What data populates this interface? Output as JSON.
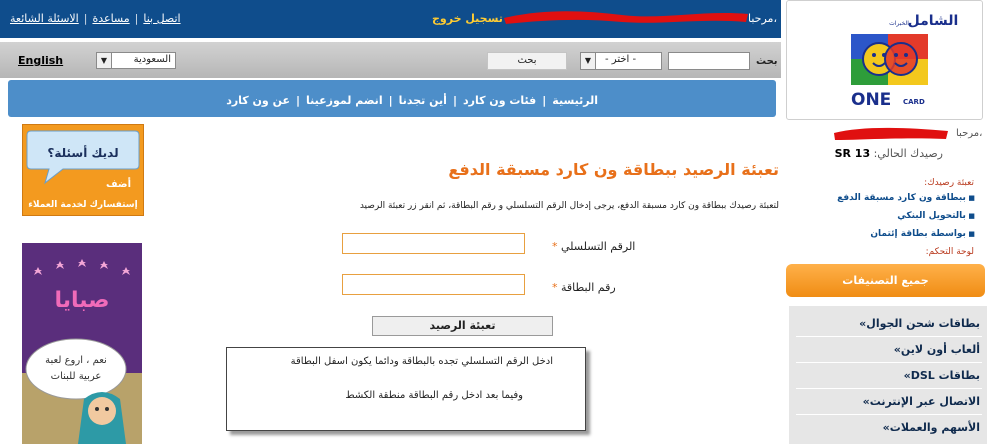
{
  "top_bar": {
    "links": [
      "اتصل بنا",
      "مساعدة",
      "الاسئلة الشائعة"
    ],
    "logout_label": "تسجيل خروج",
    "welcome_label": "مرحبا،"
  },
  "search_bar": {
    "language_label": "English",
    "country_value": "السعودية",
    "search_button": "بحث",
    "category_value": "- اختر -",
    "search_label": "بحث"
  },
  "nav": {
    "items": [
      "الرئيسية",
      "فئات ون كارد",
      "أين تجدنا",
      "انضم لموزعينا",
      "عن ون كارد"
    ]
  },
  "logo": {
    "top_text": "الشامل",
    "small_text": "الخبرات",
    "brand": "ONE",
    "brand_small": "CARD"
  },
  "sidebar": {
    "welcome": "مرحبا،",
    "balance_label": "رصيدك الحالي:",
    "balance_value": "SR 13",
    "recharge_heading": "تعبئة رصيدك:",
    "recharge_links": [
      "ببطاقة ون كارد مسبقة الدفع",
      "بالتحويل البنكي",
      "بواسطة بطاقة إئتمان"
    ],
    "panel_heading": "لوحة التحكم:",
    "all_categories_button": "جميع التصنيفات",
    "categories": [
      "بطاقات شحن الجوال",
      "ألعاب أون لاين",
      "بطاقات DSL",
      "الاتصال عبر الإنترنت",
      "الأسهم والعملات"
    ]
  },
  "ads": {
    "ad1_line1": "لديك أسئلة؟",
    "ad1_line2": "أضف",
    "ad1_line3": "إستفسارك لخدمة العملاء",
    "ad2_title": "صبايا",
    "ad2_bubble_line1": "نعم ، اروع لعبة",
    "ad2_bubble_line2": "عربية للبنات"
  },
  "main": {
    "title": "تعبئة الرصيد ببطاقة ون كارد مسبقة الدفع",
    "description": "لتعبئة رصيدك ببطاقة ون كارد مسبقة الدفع، يرجى إدخال الرقم التسلسلي و رقم البطاقة، ثم انقر زر تعبئة الرصيد",
    "serial_label": "الرقم التسلسلي",
    "card_label": "رقم البطاقة",
    "required_mark": "*",
    "submit_button": "تعبئة الرصيد",
    "tooltip_line1": "ادخل الرقم التسلسلي تجده بالبطاقة ودائما يكون اسفل البطاقة",
    "tooltip_line2": "وفيما بعد ادخل رقم البطاقة منطقة الكشط"
  },
  "colors": {
    "top_bar": "#0f4d8c",
    "nav": "#4d8ec9",
    "accent_orange": "#e8701a",
    "redaction": "#e01010"
  }
}
